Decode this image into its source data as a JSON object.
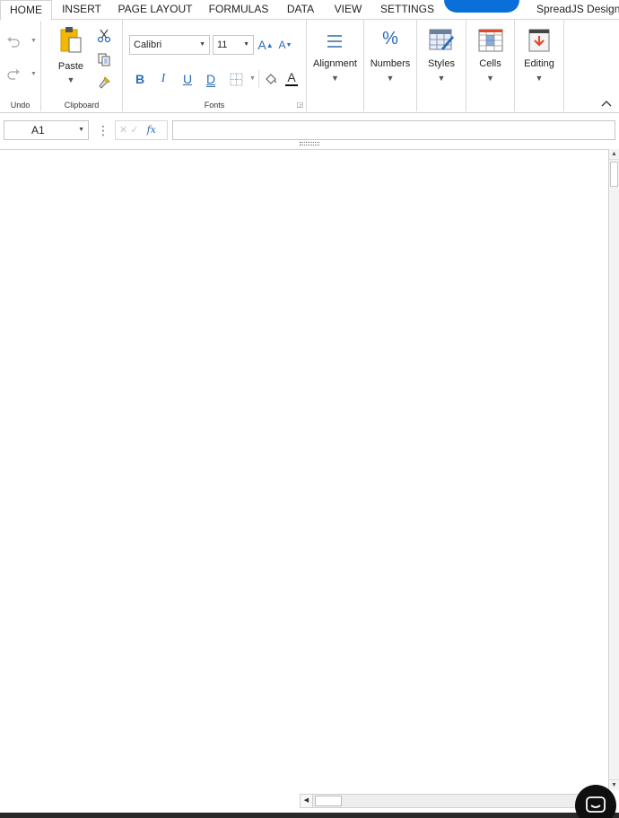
{
  "tabs": [
    "HOME",
    "INSERT",
    "PAGE LAYOUT",
    "FORMULAS",
    "DATA",
    "VIEW",
    "SETTINGS"
  ],
  "active_tab": "HOME",
  "designer_label": "SpreadJS Design",
  "ribbon": {
    "undo_group_label": "Undo",
    "clipboard_group_label": "Clipboard",
    "paste_label": "Paste",
    "fonts_group_label": "Fonts",
    "font_name": "Calibri",
    "font_size": "11",
    "bold": "B",
    "italic": "I",
    "underline": "U",
    "double_underline": "D",
    "font_color_glyph": "A",
    "increase_font_glyph": "A",
    "decrease_font_glyph": "A",
    "alignment_label": "Alignment",
    "numbers_label": "Numbers",
    "numbers_glyph": "%",
    "styles_label": "Styles",
    "cells_label": "Cells",
    "editing_label": "Editing"
  },
  "formula_bar": {
    "name_box": "A1",
    "fx_label": "fx",
    "formula": ""
  },
  "colors": {
    "accent": "#2b6cb7",
    "redaction": "#0a6fd8",
    "paste_yellow": "#f2b900",
    "editing_red": "#e0492e"
  },
  "icons": {
    "undo": "undo-icon",
    "redo": "redo-icon",
    "paste": "clipboard-icon",
    "cut": "scissors-icon",
    "copy": "copy-icon",
    "format_painter": "paintbrush-icon",
    "borders": "border-icon",
    "fill": "paint-bucket-icon",
    "alignment": "align-lines-icon",
    "styles": "table-style-icon",
    "cells": "grid-icon",
    "editing": "download-arrow-icon",
    "collapse": "chevron-up-icon",
    "chat": "chat-icon"
  }
}
